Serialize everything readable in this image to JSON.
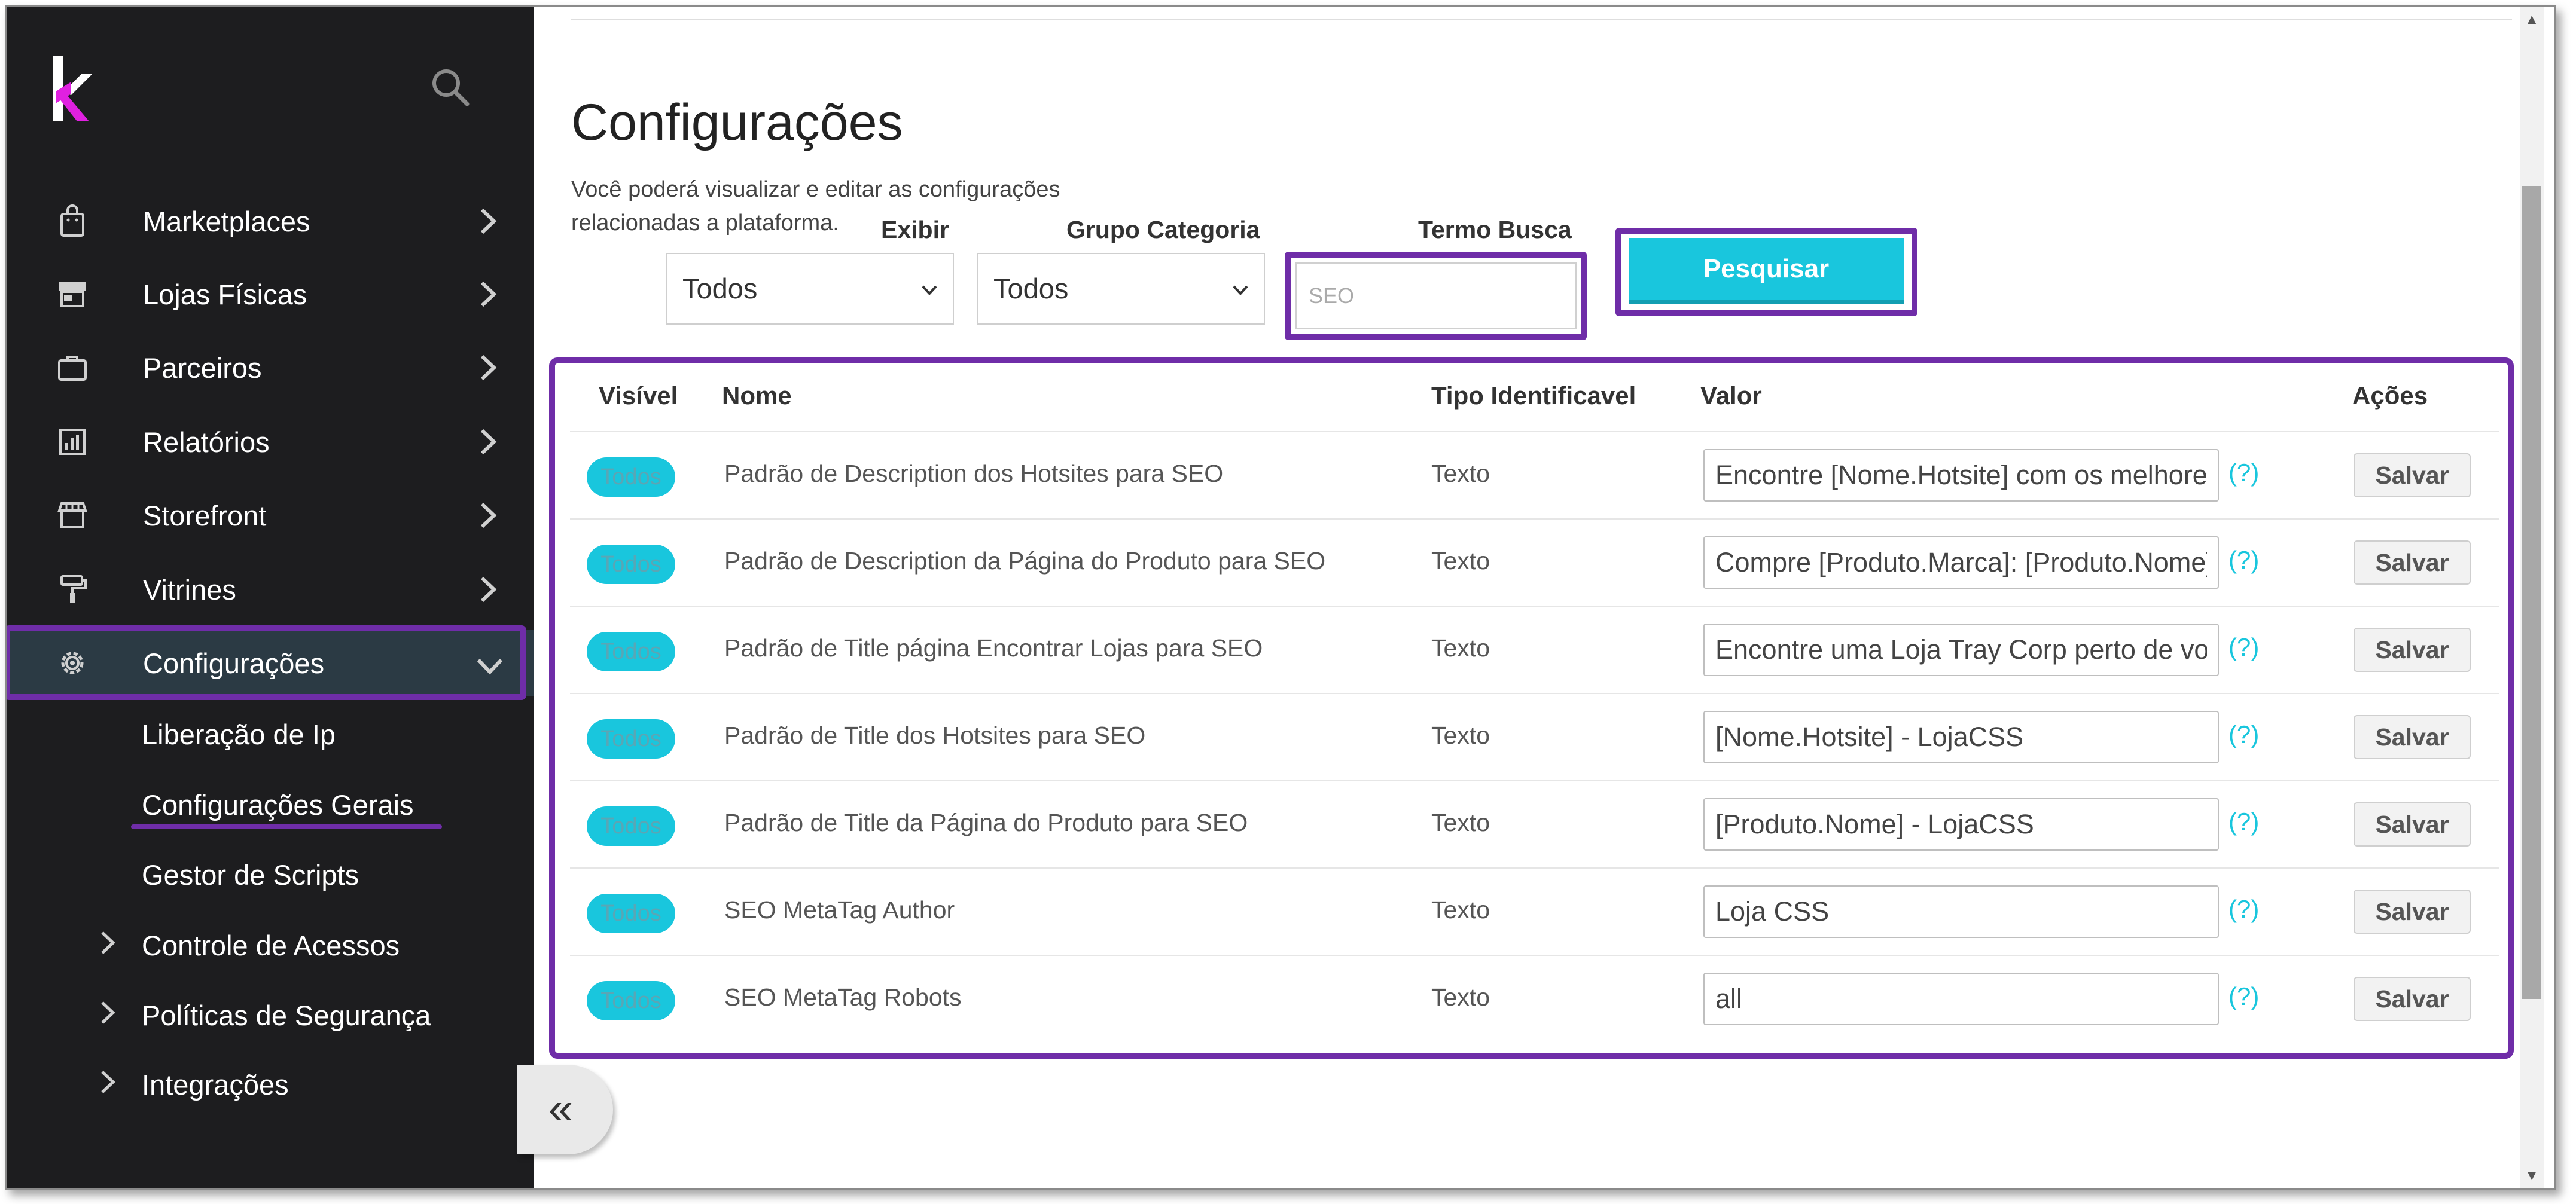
{
  "sidebar": {
    "items": [
      {
        "label": "Marketplaces",
        "icon": "shopping-bag-icon"
      },
      {
        "label": "Lojas Físicas",
        "icon": "store-icon"
      },
      {
        "label": "Parceiros",
        "icon": "briefcase-icon"
      },
      {
        "label": "Relatórios",
        "icon": "report-chart-icon"
      },
      {
        "label": "Storefront",
        "icon": "storefront-icon"
      },
      {
        "label": "Vitrines",
        "icon": "paint-roller-icon"
      },
      {
        "label": "Configurações",
        "icon": "gear-icon",
        "active": true
      }
    ],
    "sub_items": [
      {
        "label": "Liberação de Ip"
      },
      {
        "label": "Configurações Gerais",
        "selected": true
      },
      {
        "label": "Gestor de Scripts"
      },
      {
        "label": "Controle de Acessos",
        "expandable": true
      },
      {
        "label": "Políticas de Segurança",
        "expandable": true
      },
      {
        "label": "Integrações",
        "expandable": true
      }
    ]
  },
  "main": {
    "title": "Configurações",
    "description": "Você poderá visualizar e editar as configurações relacionadas a plataforma.",
    "filters": {
      "exibir_label": "Exibir",
      "exibir_value": "Todos",
      "grupo_label": "Grupo Categoria",
      "grupo_value": "Todos",
      "termo_label": "Termo Busca",
      "termo_value": "SEO"
    },
    "search_button": "Pesquisar",
    "table": {
      "headers": [
        "Visível",
        "Nome",
        "Tipo Identificavel",
        "Valor",
        "Ações"
      ],
      "rows": [
        {
          "visible": "Todos",
          "name": "Padrão de Description dos Hotsites para SEO",
          "type": "Texto",
          "value": "Encontre [Nome.Hotsite] com os melhores",
          "help": "(?)",
          "action": "Salvar"
        },
        {
          "visible": "Todos",
          "name": "Padrão de Description da Página do Produto para SEO",
          "type": "Texto",
          "value": "Compre [Produto.Marca]: [Produto.Nome]",
          "help": "(?)",
          "action": "Salvar"
        },
        {
          "visible": "Todos",
          "name": "Padrão de Title página Encontrar Lojas para SEO",
          "type": "Texto",
          "value": "Encontre uma Loja Tray Corp perto de você",
          "help": "(?)",
          "action": "Salvar"
        },
        {
          "visible": "Todos",
          "name": "Padrão de Title dos Hotsites para SEO",
          "type": "Texto",
          "value": "[Nome.Hotsite] - LojaCSS",
          "help": "(?)",
          "action": "Salvar"
        },
        {
          "visible": "Todos",
          "name": "Padrão de Title da Página do Produto para SEO",
          "type": "Texto",
          "value": "[Produto.Nome] - LojaCSS",
          "help": "(?)",
          "action": "Salvar"
        },
        {
          "visible": "Todos",
          "name": "SEO MetaTag Author",
          "type": "Texto",
          "value": "Loja CSS",
          "help": "(?)",
          "action": "Salvar"
        },
        {
          "visible": "Todos",
          "name": "SEO MetaTag Robots",
          "type": "Texto",
          "value": "all",
          "help": "(?)",
          "action": "Salvar"
        }
      ]
    },
    "collapse_icon": "double-chevron-left-icon"
  },
  "colors": {
    "sidebar_bg": "#1d1d1f",
    "highlight": "#6f2da8",
    "accent": "#19c6dd",
    "logo_magenta": "#e020e0"
  }
}
